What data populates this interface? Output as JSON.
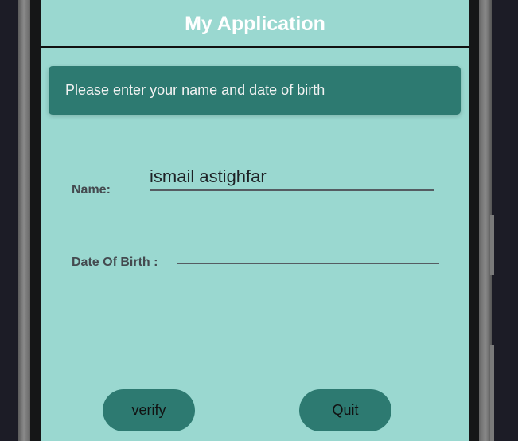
{
  "app": {
    "title": "My Application"
  },
  "banner": {
    "text": "Please enter your name and date of birth"
  },
  "form": {
    "name_label": "Name:",
    "name_value": "ismail astighfar",
    "dob_label": "Date Of Birth :",
    "dob_value": ""
  },
  "buttons": {
    "verify": "verify",
    "quit": "Quit"
  },
  "colors": {
    "screen_bg": "#9ad8d0",
    "accent": "#2d7a71"
  }
}
